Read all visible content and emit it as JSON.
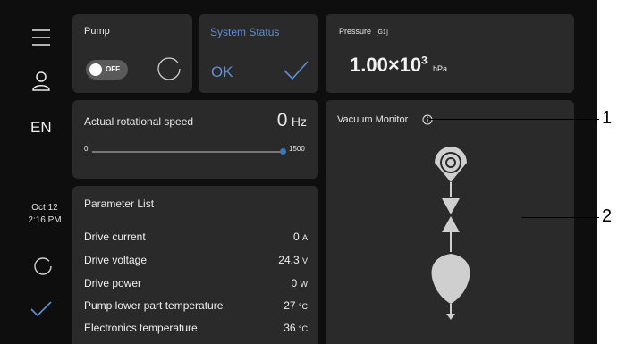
{
  "sidebar": {
    "language": "EN",
    "date": "Oct 12",
    "time": "2:16 PM"
  },
  "pump": {
    "title": "Pump",
    "toggle_label": "OFF"
  },
  "system_status": {
    "title": "System Status",
    "value": "OK",
    "accent": "#5c8fd6"
  },
  "pressure": {
    "title": "Pressure",
    "gauge_tag": "[G1]",
    "mantissa": "1.00×10",
    "exponent": "3",
    "unit": "hPa"
  },
  "speed": {
    "title": "Actual rotational speed",
    "value": "0",
    "unit": "Hz",
    "slider_min": "0",
    "slider_max": "1500",
    "slider_fraction": 1.0
  },
  "parameters": {
    "title": "Parameter List",
    "rows": [
      {
        "label": "Drive current",
        "value": "0",
        "unit": "A"
      },
      {
        "label": "Drive voltage",
        "value": "24.3",
        "unit": "V"
      },
      {
        "label": "Drive power",
        "value": "0",
        "unit": "W"
      },
      {
        "label": "Pump lower part temperature",
        "value": "27",
        "unit": "°C"
      },
      {
        "label": "Electronics temperature",
        "value": "36",
        "unit": "°C"
      }
    ]
  },
  "vacuum_monitor": {
    "title": "Vacuum Monitor"
  },
  "callouts": [
    "1",
    "2"
  ]
}
